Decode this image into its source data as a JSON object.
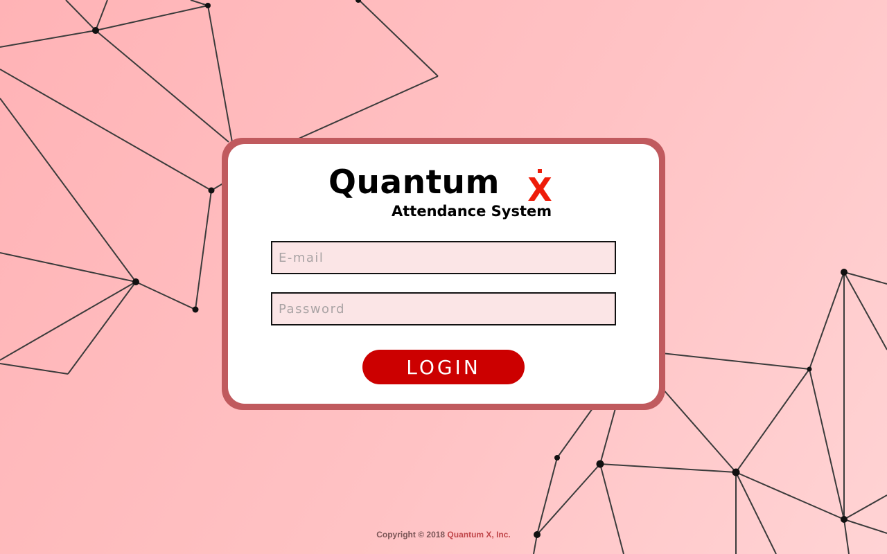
{
  "app": {
    "logo_word": "Quantum",
    "logo_letter": "X",
    "subtitle": "Attendance System"
  },
  "form": {
    "email_placeholder": "E-mail",
    "email_value": "",
    "password_placeholder": "Password",
    "password_value": "",
    "login_label": "LOGIN"
  },
  "footer": {
    "copyright_prefix": "Copyright © 2018 ",
    "company": "Quantum X, Inc."
  },
  "colors": {
    "accent": "#cc0000",
    "frame": "#c05a5e",
    "background_start": "#ffb3b6",
    "background_end": "#ffd3d4",
    "input_fill": "#fbe5e6"
  },
  "icons": {
    "logo_x": "x-logo-icon",
    "background": "network-graph-decoration"
  }
}
